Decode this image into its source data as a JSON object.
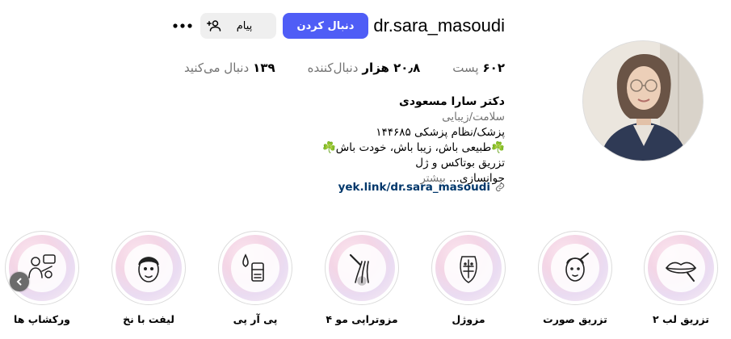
{
  "profile": {
    "username": "dr.sara_masoudi",
    "follow_label": "دنبال کردن",
    "message_label": "پیام"
  },
  "stats": {
    "posts_count": "۶۰۲",
    "posts_label": "پست",
    "followers_count": "۲۰٫۸ هزار",
    "followers_label": "دنبال‌کننده",
    "following_count": "۱۳۹",
    "following_label": "دنبال می‌کنید"
  },
  "bio": {
    "name": "دکتر سارا مسعودی",
    "category": "سلامت/زیبایی",
    "line1": "پزشک/نظام پزشکی ۱۴۴۶۸۵",
    "line2": "☘️طبیعی باش، زیبا باش، خودت باش☘️",
    "line3": "تزریق بوتاکس و ژل",
    "line4_text": "جوانسازی...",
    "line4_more": "بیشتر",
    "link": "yek.link/dr.sara_masoudi"
  },
  "highlights": [
    {
      "label": "تزریق لب ۲",
      "icon": "lips-icon"
    },
    {
      "label": "تزریق صورت",
      "icon": "face-injection-icon"
    },
    {
      "label": "مزوژل",
      "icon": "face-mesh-icon"
    },
    {
      "label": "مزوتراپی مو ۴",
      "icon": "hair-mesotherapy-icon"
    },
    {
      "label": "پی آر پی",
      "icon": "prp-tube-icon"
    },
    {
      "label": "لیفت با نخ",
      "icon": "thread-lift-icon"
    },
    {
      "label": "ورکشاپ ها",
      "icon": "workshop-icon"
    }
  ],
  "colors": {
    "accent": "#4f5df6",
    "link": "#00376b",
    "muted": "#737373"
  }
}
